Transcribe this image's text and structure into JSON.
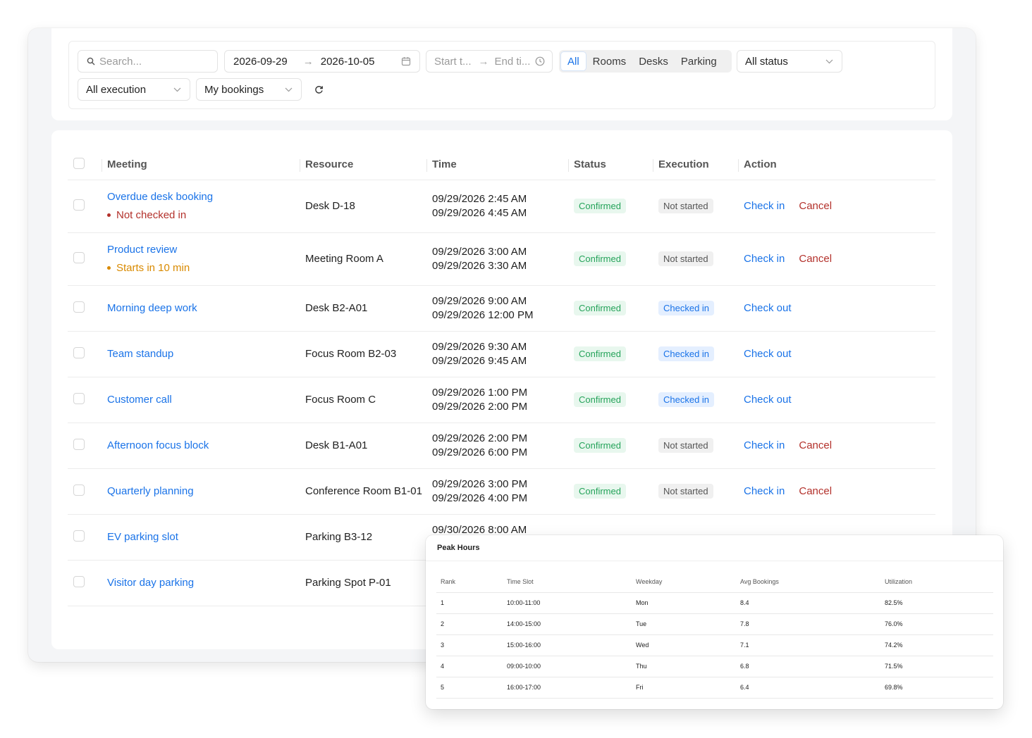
{
  "filters": {
    "search_placeholder": "Search...",
    "date_start": "2026-09-29",
    "date_end": "2026-10-05",
    "time_start_placeholder": "Start t...",
    "time_end_placeholder": "End ti...",
    "type_segments": [
      "All",
      "Rooms",
      "Desks",
      "Parking"
    ],
    "type_selected": "All",
    "status_select": "All status",
    "execution_select": "All execution",
    "scope_select": "My bookings"
  },
  "table": {
    "headers": [
      "Meeting",
      "Resource",
      "Time",
      "Status",
      "Execution",
      "Action"
    ],
    "rows": [
      {
        "meeting": "Overdue desk booking",
        "note": "Not checked in",
        "note_color": "#b3312b",
        "resource": "Desk D-18",
        "start": "09/29/2026 2:45 AM",
        "end": "09/29/2026 4:45 AM",
        "status": "Confirmed",
        "execution": "Not started",
        "action": "Check in",
        "cancel": "Cancel"
      },
      {
        "meeting": "Product review",
        "note": "Starts in 10 min",
        "note_color": "#d98a00",
        "resource": "Meeting Room A",
        "start": "09/29/2026 3:00 AM",
        "end": "09/29/2026 3:30 AM",
        "status": "Confirmed",
        "execution": "Not started",
        "action": "Check in",
        "cancel": "Cancel"
      },
      {
        "meeting": "Morning deep work",
        "note": "",
        "resource": "Desk B2-A01",
        "start": "09/29/2026 9:00 AM",
        "end": "09/29/2026 12:00 PM",
        "status": "Confirmed",
        "execution": "Checked in",
        "action": "Check out",
        "cancel": ""
      },
      {
        "meeting": "Team standup",
        "note": "",
        "resource": "Focus Room B2-03",
        "start": "09/29/2026 9:30 AM",
        "end": "09/29/2026 9:45 AM",
        "status": "Confirmed",
        "execution": "Checked in",
        "action": "Check out",
        "cancel": ""
      },
      {
        "meeting": "Customer call",
        "note": "",
        "resource": "Focus Room C",
        "start": "09/29/2026 1:00 PM",
        "end": "09/29/2026 2:00 PM",
        "status": "Confirmed",
        "execution": "Checked in",
        "action": "Check out",
        "cancel": ""
      },
      {
        "meeting": "Afternoon focus block",
        "note": "",
        "resource": "Desk B1-A01",
        "start": "09/29/2026 2:00 PM",
        "end": "09/29/2026 6:00 PM",
        "status": "Confirmed",
        "execution": "Not started",
        "action": "Check in",
        "cancel": "Cancel"
      },
      {
        "meeting": "Quarterly planning",
        "note": "",
        "resource": "Conference Room B1-01",
        "start": "09/29/2026 3:00 PM",
        "end": "09/29/2026 4:00 PM",
        "status": "Confirmed",
        "execution": "Not started",
        "action": "Check in",
        "cancel": "Cancel"
      },
      {
        "meeting": "EV parking slot",
        "note": "",
        "resource": "Parking B3-12",
        "start": "09/30/2026 8:00 AM",
        "end": "",
        "status": "",
        "execution": "",
        "action": "",
        "cancel": ""
      },
      {
        "meeting": "Visitor day parking",
        "note": "",
        "resource": "Parking Spot P-01",
        "start": "",
        "end": "",
        "status": "",
        "execution": "",
        "action": "",
        "cancel": ""
      }
    ]
  },
  "peak_hours": {
    "title": "Peak Hours",
    "headers": [
      "Rank",
      "Time Slot",
      "Weekday",
      "Avg Bookings",
      "Utilization"
    ],
    "rows": [
      [
        "1",
        "10:00-11:00",
        "Mon",
        "8.4",
        "82.5%"
      ],
      [
        "2",
        "14:00-15:00",
        "Tue",
        "7.8",
        "76.0%"
      ],
      [
        "3",
        "15:00-16:00",
        "Wed",
        "7.1",
        "74.2%"
      ],
      [
        "4",
        "09:00-10:00",
        "Thu",
        "6.8",
        "71.5%"
      ],
      [
        "5",
        "16:00-17:00",
        "Fri",
        "6.4",
        "69.8%"
      ]
    ]
  }
}
